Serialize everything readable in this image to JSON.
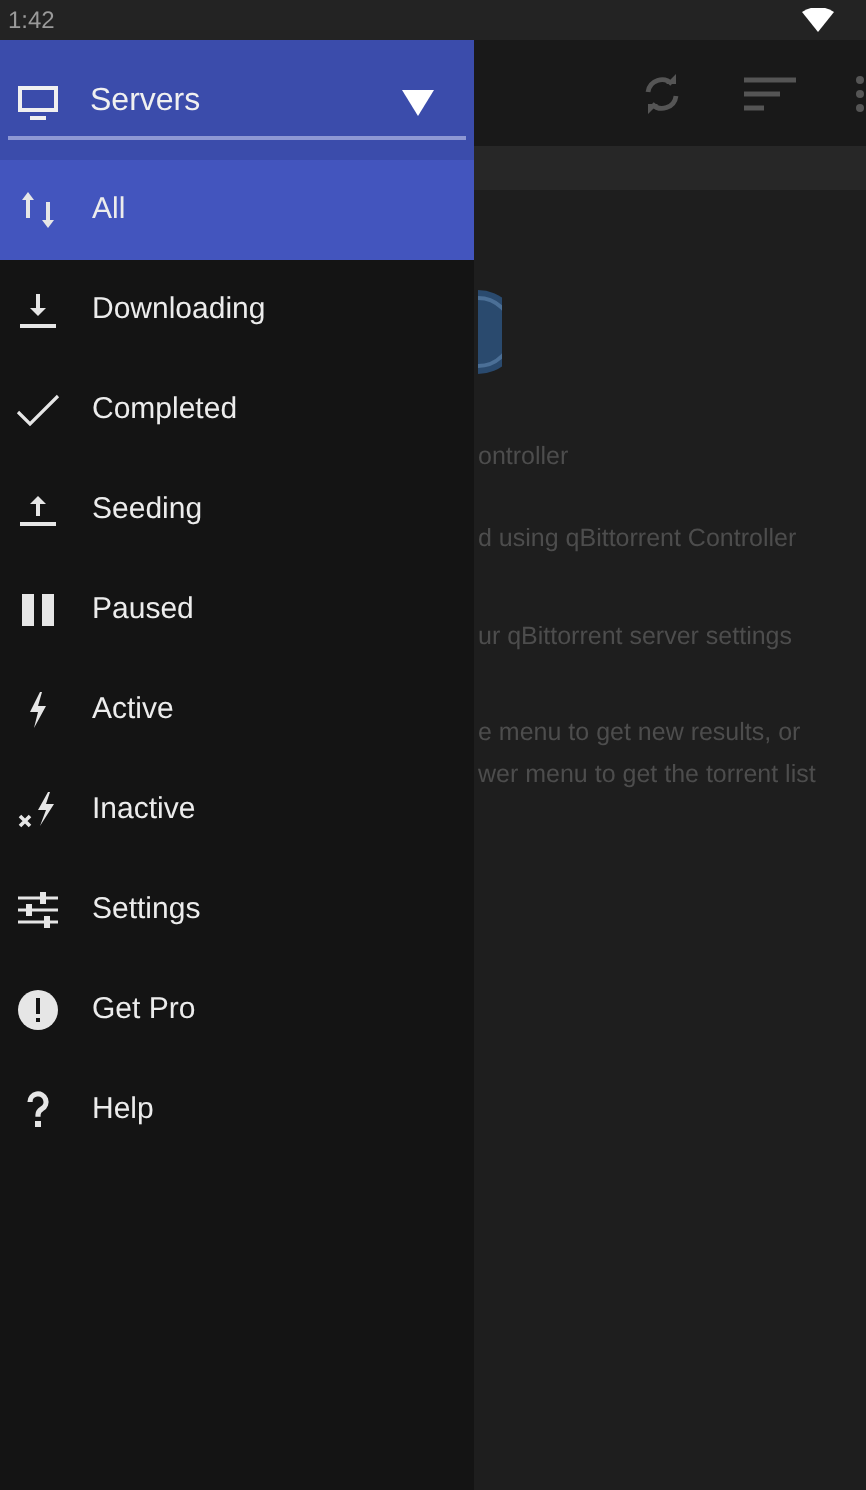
{
  "status_bar": {
    "time": "1:42"
  },
  "drawer": {
    "header": {
      "label": "Servers",
      "expanded": false
    },
    "items": [
      {
        "label": "All",
        "selected": true
      },
      {
        "label": "Downloading",
        "selected": false
      },
      {
        "label": "Completed",
        "selected": false
      },
      {
        "label": "Seeding",
        "selected": false
      },
      {
        "label": "Paused",
        "selected": false
      },
      {
        "label": "Active",
        "selected": false
      },
      {
        "label": "Inactive",
        "selected": false
      },
      {
        "label": "Settings",
        "selected": false
      },
      {
        "label": "Get Pro",
        "selected": false
      },
      {
        "label": "Help",
        "selected": false
      }
    ]
  },
  "background": {
    "lines": [
      "ontroller",
      "d using qBittorrent Controller",
      "ur qBittorrent server settings",
      "e menu to get new results, or",
      "wer menu to get the torrent list"
    ]
  }
}
